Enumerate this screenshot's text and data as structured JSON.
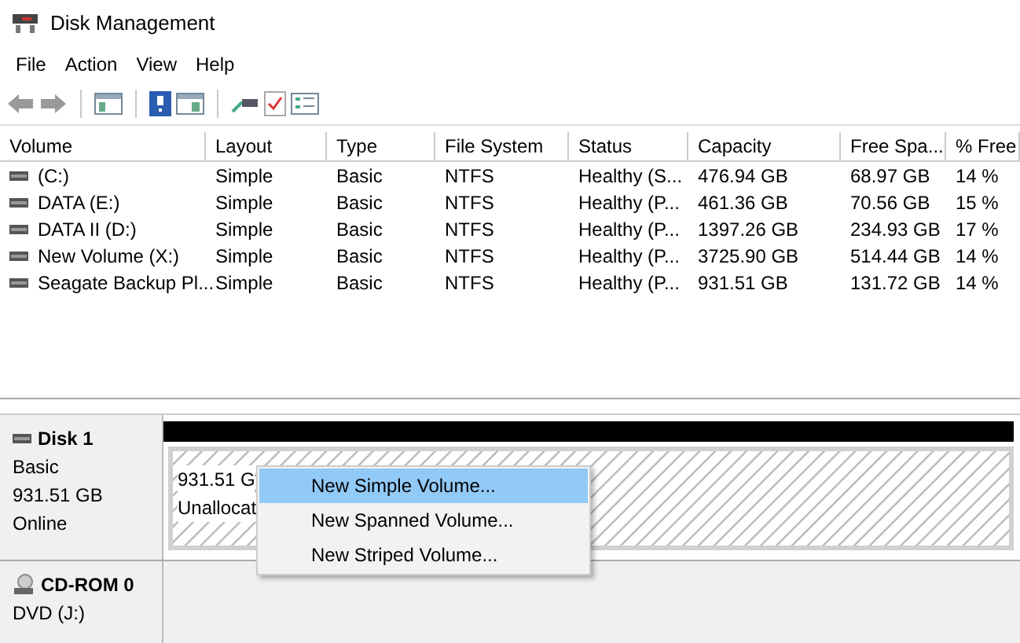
{
  "window": {
    "title": "Disk Management"
  },
  "menu": [
    "File",
    "Action",
    "View",
    "Help"
  ],
  "table": {
    "columns": [
      "Volume",
      "Layout",
      "Type",
      "File System",
      "Status",
      "Capacity",
      "Free Spa...",
      "% Free"
    ],
    "rows": [
      [
        "(C:)",
        "Simple",
        "Basic",
        "NTFS",
        "Healthy (S...",
        "476.94 GB",
        "68.97 GB",
        "14 %"
      ],
      [
        "DATA (E:)",
        "Simple",
        "Basic",
        "NTFS",
        "Healthy (P...",
        "461.36 GB",
        "70.56 GB",
        "15 %"
      ],
      [
        "DATA II (D:)",
        "Simple",
        "Basic",
        "NTFS",
        "Healthy (P...",
        "1397.26 GB",
        "234.93 GB",
        "17 %"
      ],
      [
        "New Volume (X:)",
        "Simple",
        "Basic",
        "NTFS",
        "Healthy (P...",
        "3725.90 GB",
        "514.44 GB",
        "14 %"
      ],
      [
        "Seagate Backup Pl...",
        "Simple",
        "Basic",
        "NTFS",
        "Healthy (P...",
        "931.51 GB",
        "131.72 GB",
        "14 %"
      ]
    ]
  },
  "disks": [
    {
      "kind": "disk",
      "name": "Disk 1",
      "lines": [
        "Basic",
        "931.51 GB",
        "Online"
      ],
      "partition": [
        "931.51 G",
        "Unallocat"
      ]
    },
    {
      "kind": "cdrom",
      "name": "CD-ROM 0",
      "lines": [
        "DVD (J:)"
      ]
    }
  ],
  "context_menu": [
    {
      "label": "New Simple Volume...",
      "selected": true
    },
    {
      "label": "New Spanned Volume...",
      "selected": false
    },
    {
      "label": "New Striped Volume...",
      "selected": false
    }
  ]
}
